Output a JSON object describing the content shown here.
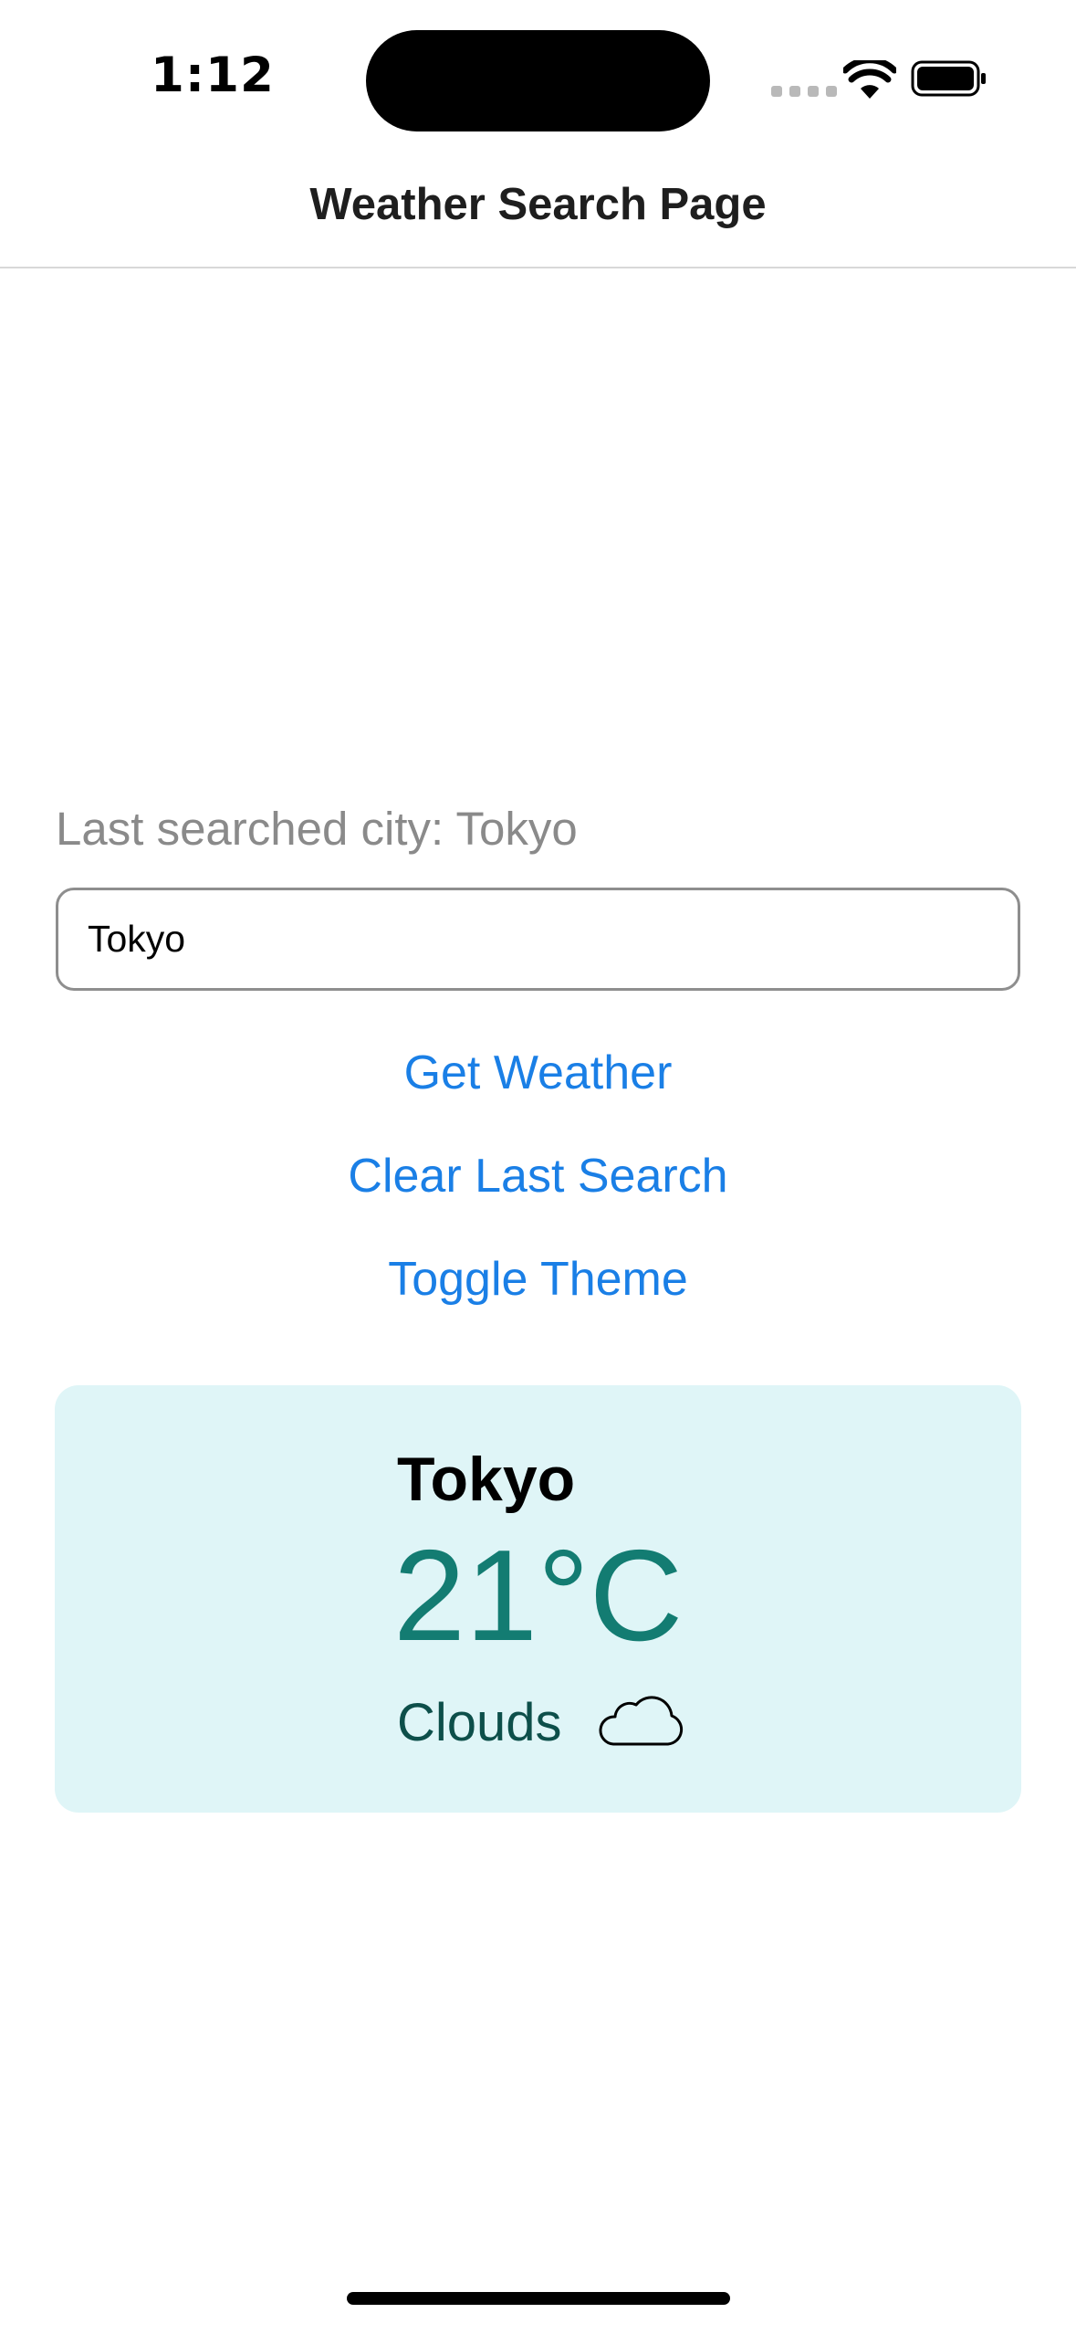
{
  "status_bar": {
    "time": "1:12",
    "icons": [
      "signal-icon",
      "wifi-icon",
      "battery-icon"
    ]
  },
  "nav": {
    "title": "Weather Search Page"
  },
  "search": {
    "last_searched_label": "Last searched city: Tokyo",
    "input_value": "Tokyo"
  },
  "buttons": {
    "get_weather": "Get Weather",
    "clear_last_search": "Clear Last Search",
    "toggle_theme": "Toggle Theme"
  },
  "weather": {
    "city": "Tokyo",
    "temperature": "21°C",
    "condition": "Clouds",
    "condition_icon": "cloud-icon"
  },
  "colors": {
    "link": "#1a7fe6",
    "card_background": "#dff5f7",
    "temperature": "#137c72",
    "condition_text": "#0d4f4a",
    "muted_text": "#8a8a8a"
  }
}
